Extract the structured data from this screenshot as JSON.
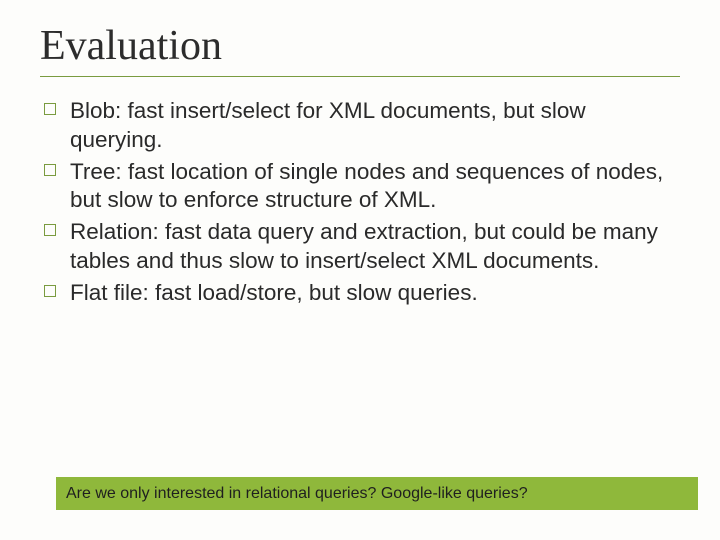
{
  "title": "Evaluation",
  "bullets": [
    {
      "text": "Blob: fast insert/select for XML documents, but slow querying."
    },
    {
      "text": "Tree: fast location of single nodes and sequences of nodes, but slow to enforce structure of XML."
    },
    {
      "text": "Relation: fast data query and extraction, but could be many tables and thus slow to insert/select XML documents."
    },
    {
      "text": "Flat file: fast load/store, but slow queries."
    }
  ],
  "footer": "Are we only interested in relational queries? Google-like queries?"
}
